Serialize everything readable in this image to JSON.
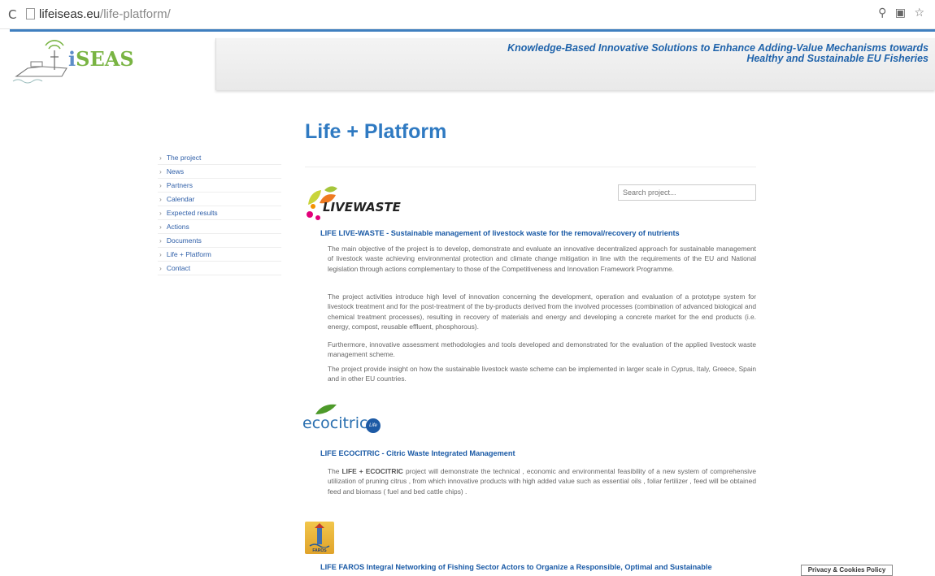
{
  "browser": {
    "reload_glyph": "C",
    "url_host": "lifeiseas.eu",
    "url_path": "/life-platform/",
    "tools_glyphs": "⚲ ▣ ☆"
  },
  "header": {
    "logo_text_i": "i",
    "logo_text_rest": "SEAS",
    "tagline_line1": "Knowledge-Based Innovative Solutions to Enhance Adding-Value Mechanisms towards",
    "tagline_line2": "Healthy and Sustainable EU Fisheries"
  },
  "nav": {
    "arrow": "›",
    "items": [
      {
        "label": "The project"
      },
      {
        "label": "News"
      },
      {
        "label": "Partners"
      },
      {
        "label": "Calendar"
      },
      {
        "label": "Expected results"
      },
      {
        "label": "Actions"
      },
      {
        "label": "Documents"
      },
      {
        "label": "Life + Platform"
      },
      {
        "label": "Contact"
      }
    ]
  },
  "main": {
    "title": "Life + Platform",
    "search_placeholder": "Search project...",
    "projects": [
      {
        "logo_text": "LIVEWASTE",
        "title": "LIFE LIVE-WASTE - Sustainable management of livestock waste for the removal/recovery of nutrients",
        "paragraphs": [
          "The main objective of the project is to develop, demonstrate and evaluate an innovative decentralized approach for sustainable management of livestock waste achieving environmental protection and climate change mitigation in line with the requirements of the EU and National legislation through actions complementary to those of the Competitiveness and Innovation Framework Programme.",
          "The project activities introduce high level of innovation concerning the development, operation and evaluation of a prototype system for livestock treatment and for the post-treatment of the by-products derived from the involved processes (combination of advanced biological and chemical treatment processes), resulting in recovery of materials and energy and developing a concrete market for the end products (i.e. energy, compost, reusable effluent, phosphorous).",
          "Furthermore, innovative assessment methodologies and tools developed and demonstrated for the evaluation of the applied livestock waste management scheme.",
          "The project provide insight on how the sustainable livestock waste scheme can be implemented in larger scale in Cyprus, Italy, Greece, Spain and in other EU countries."
        ]
      },
      {
        "logo_text": "ecocitric",
        "logo_badge": "Life",
        "title": "LIFE ECOCITRIC - Citric Waste Integrated Management",
        "para_prefix": "The ",
        "para_bold": "LIFE + ECOCITRIC",
        "para_rest": " project will demonstrate the technical , economic and environmental feasibility of a new system of comprehensive utilization of pruning citrus , from which innovative products with high added value such as essential oils , foliar fertilizer , feed will be obtained feed and biomass ( fuel and bed cattle chips) ."
      },
      {
        "logo_text": "FAROS",
        "title": "LIFE FAROS Integral Networking of Fishing Sector Actors to Organize a Responsible, Optimal and Sustainable"
      }
    ]
  },
  "privacy_label": "Privacy & Cookies Policy"
}
